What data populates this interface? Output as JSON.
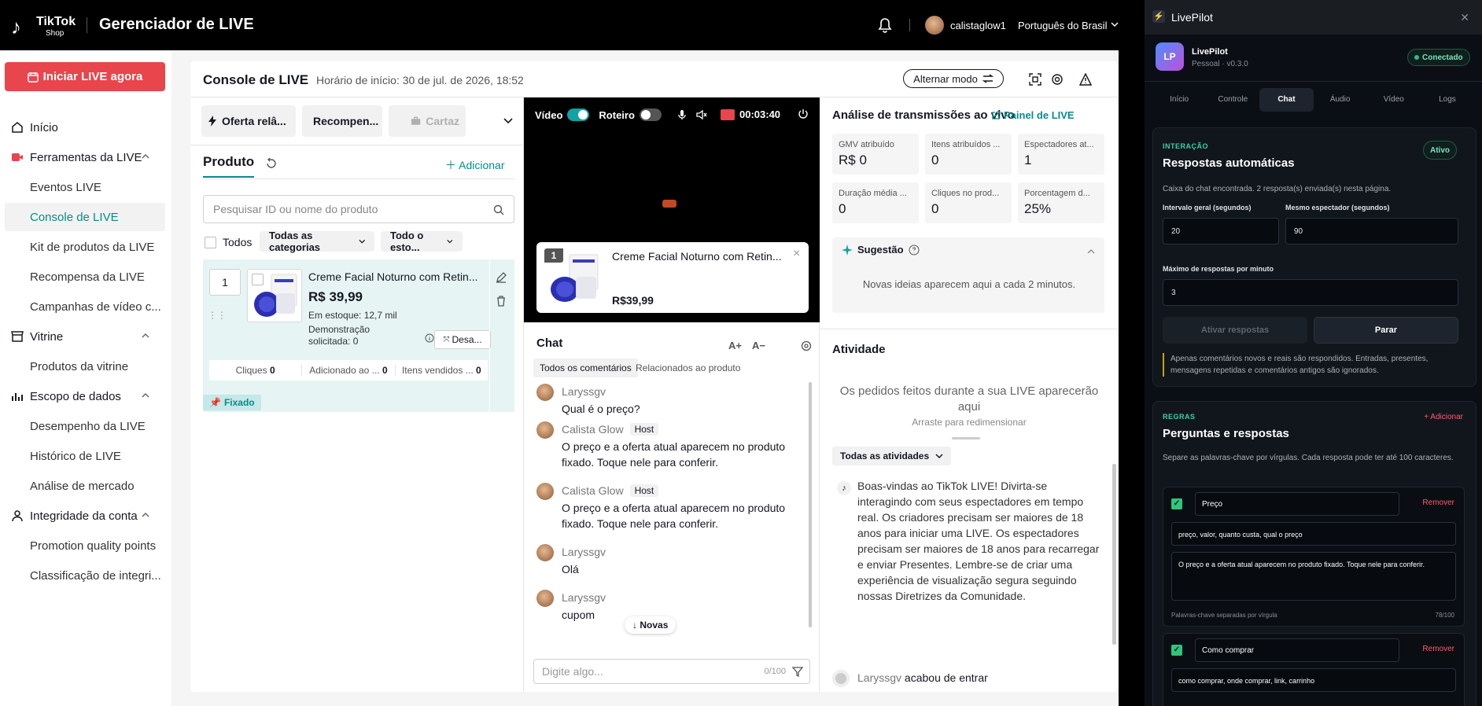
{
  "topbar": {
    "brand": "TikTok",
    "brand_sub": "Shop",
    "title": "Gerenciador de LIVE",
    "username": "calistaglow1",
    "language": "Português do Brasil"
  },
  "sidebar": {
    "go_live": "Iniciar LIVE agora",
    "items": [
      {
        "label": "Início",
        "icon": "home-icon"
      },
      {
        "label": "Ferramentas da LIVE",
        "icon": "video-icon"
      },
      {
        "label": "Eventos LIVE"
      },
      {
        "label": "Console de LIVE"
      },
      {
        "label": "Kit de produtos da LIVE"
      },
      {
        "label": "Recompensa da LIVE"
      },
      {
        "label": "Campanhas de vídeo c..."
      },
      {
        "label": "Vitrine",
        "icon": "store-icon"
      },
      {
        "label": "Produtos da vitrine"
      },
      {
        "label": "Escopo de dados",
        "icon": "bar-chart-icon"
      },
      {
        "label": "Desempenho da LIVE"
      },
      {
        "label": "Histórico de LIVE"
      },
      {
        "label": "Análise de mercado"
      },
      {
        "label": "Integridade da conta",
        "icon": "user-icon"
      },
      {
        "label": "Promotion quality points"
      },
      {
        "label": "Classificação de integri..."
      }
    ]
  },
  "console": {
    "title": "Console de LIVE",
    "start_time": "Horário de início: 30 de jul. de 2026, 18:52",
    "alt_mode": "Alternar modo"
  },
  "products": {
    "tools": [
      "Oferta relâ...",
      "Recompen...",
      "Cartaz"
    ],
    "tab": "Produto",
    "add": "Adicionar",
    "search_placeholder": "Pesquisar ID ou nome do produto",
    "all": "Todos",
    "categories": "Todas as categorias",
    "stock_filter": "Todo o esto...",
    "item": {
      "position": "1",
      "name": "Creme Facial Noturno com Retin...",
      "price": "R$ 39,99",
      "stock": "Em estoque: 12,7 mil",
      "demo_line1": "Demonstração",
      "demo_line2": "solicitada: 0",
      "unpin": "Desa...",
      "clicks_label": "Cliques",
      "clicks": "0",
      "added_label": "Adicionado ao ...",
      "added": "0",
      "sold_label": "Itens vendidos ...",
      "sold": "0",
      "pinned": "Fixado"
    }
  },
  "video": {
    "video_label": "Vídeo",
    "script_label": "Roteiro",
    "timer": "00:03:40",
    "card_position": "1",
    "card_name": "Creme Facial Noturno com Retin...",
    "card_price": "R$39,99"
  },
  "chat": {
    "title": "Chat",
    "font_up": "A+",
    "font_down": "A−",
    "tab_all": "Todos os comentários",
    "tab_product": "Relacionados ao produto",
    "host_tag": "Host",
    "messages": [
      {
        "author": "Laryssgv",
        "text": "Qual é o preço?"
      },
      {
        "author": "Calista Glow",
        "text": "O preço e a oferta atual aparecem no produto fixado. Toque nele para conferir."
      },
      {
        "author": "Calista Glow",
        "text": "O preço e a oferta atual aparecem no produto fixado. Toque nele para conferir."
      },
      {
        "author": "Laryssgv",
        "text": "Olá"
      },
      {
        "author": "Laryssgv",
        "text": "cupom"
      }
    ],
    "new_button": "Novas",
    "input_placeholder": "Digite algo...",
    "input_count": "0/100"
  },
  "analytics": {
    "title": "Análise de transmissões ao vivo",
    "panel_link": "Painel de LIVE",
    "metrics": [
      {
        "label": "GMV atribuído",
        "value": "R$ 0"
      },
      {
        "label": "Itens atribuídos ...",
        "value": "0"
      },
      {
        "label": "Espectadores at...",
        "value": "1"
      },
      {
        "label": "Duração média ...",
        "value": "0"
      },
      {
        "label": "Cliques no prod...",
        "value": "0"
      },
      {
        "label": "Porcentagem d...",
        "value": "25%"
      }
    ],
    "suggestion_title": "Sugestão",
    "suggestion_text": "Novas ideias aparecem aqui a cada 2 minutos."
  },
  "activity": {
    "title": "Atividade",
    "empty": "Os pedidos feitos durante a sua LIVE aparecerão aqui",
    "drag_hint": "Arraste para redimensionar",
    "filter": "Todas as atividades",
    "welcome": "Boas-vindas ao TikTok LIVE! Divirta-se interagindo com seus espectadores em tempo real. Os criadores precisam ser maiores de 18 anos para iniciar uma LIVE. Os espectadores precisam ser maiores de 18 anos para recarregar e enviar Presentes. Lembre-se de criar uma experiência de visualização segura seguindo nossas Diretrizes da Comunidade.",
    "joined_user": "Laryssgv",
    "joined_text": "acabou de entrar"
  },
  "livepilot": {
    "window_title": "LivePilot",
    "logo": "LP",
    "name": "LivePilot",
    "version": "Pessoal · v0.3.0",
    "status": "Conectado",
    "tabs": [
      "Início",
      "Controle",
      "Chat",
      "Áudio",
      "Vídeo",
      "Logs"
    ],
    "active_tab": "Chat",
    "auto": {
      "kicker": "INTERAÇÃO",
      "title": "Respostas automáticas",
      "badge": "Ativo",
      "status": "Caixa do chat encontrada. 2 resposta(s) enviada(s) nesta página.",
      "interval_label": "Intervalo geral (segundos)",
      "interval_value": "20",
      "same_viewer_label": "Mesmo espectador (segundos)",
      "same_viewer_value": "90",
      "max_label": "Máximo de respostas por minuto",
      "max_value": "3",
      "activate": "Ativar respostas",
      "stop": "Parar",
      "note": "Apenas comentários novos e reais são respondidos. Entradas, presentes, mensagens repetidas e comentários antigos são ignorados."
    },
    "rules": {
      "kicker": "REGRAS",
      "add": "+ Adicionar",
      "title": "Perguntas e respostas",
      "desc": "Separe as palavras-chave por vírgulas. Cada resposta pode ter até 100 caracteres.",
      "remove": "Remover",
      "hint": "Palavras-chave separadas por vírgula",
      "items": [
        {
          "name": "Preço",
          "keywords": "preço, valor, quanto custa, qual o preço",
          "reply": "O preço e a oferta atual aparecem no produto fixado. Toque nele para conferir.",
          "count": "78/100"
        },
        {
          "name": "Como comprar",
          "keywords": "como comprar, onde comprar, link, carrinho"
        }
      ]
    }
  }
}
